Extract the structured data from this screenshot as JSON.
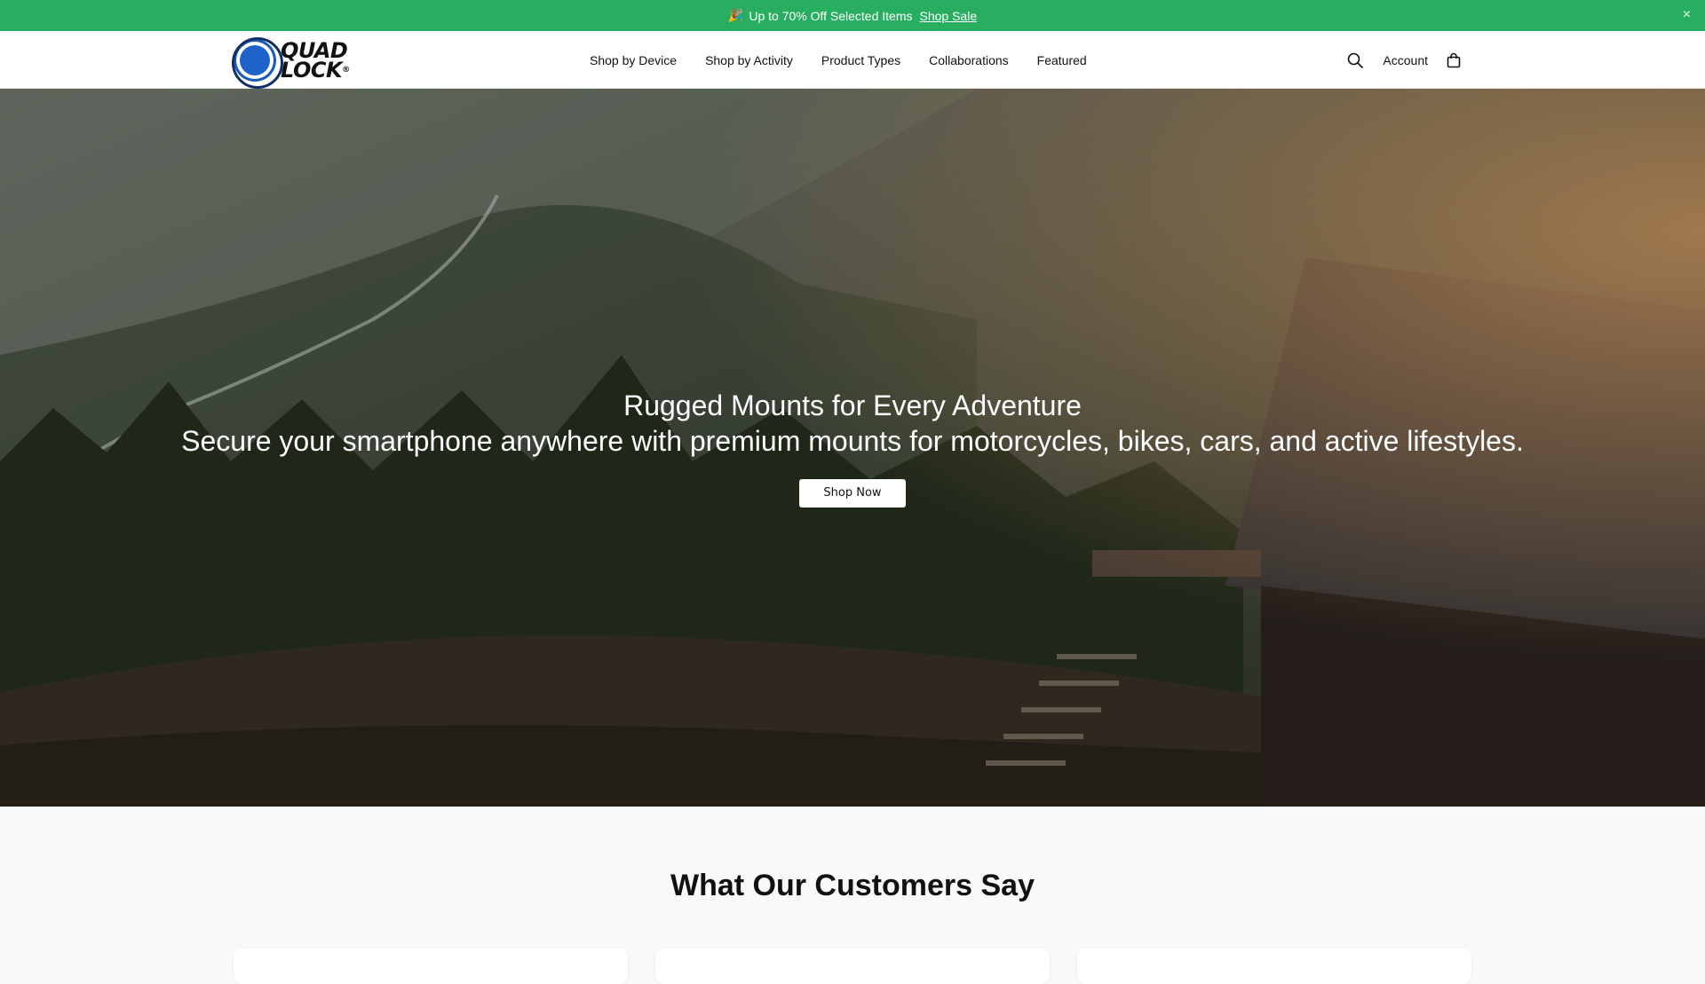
{
  "announcement": {
    "emoji": "🎉",
    "text": "Up to 70% Off Selected Items",
    "link": "Shop Sale",
    "close": "×"
  },
  "header": {
    "logo_line1": "QUAD",
    "logo_line2": "LOCK",
    "logo_reg": "®",
    "nav": [
      "Shop by Device",
      "Shop by Activity",
      "Product Types",
      "Collaborations",
      "Featured"
    ],
    "account_label": "Account"
  },
  "hero": {
    "title": "Rugged Mounts for Every Adventure",
    "subtitle": "Secure your smartphone anywhere with premium mounts for motorcycles, bikes, cars, and active lifestyles.",
    "cta": "Shop Now"
  },
  "testimonials": {
    "heading": "What Our Customers Say"
  },
  "colors": {
    "announcement_bg": "#27ae60",
    "brand_blue": "#1a5ab8"
  },
  "icons": {
    "search": "search-icon",
    "cart": "shopping-bag-icon",
    "close": "close-icon"
  }
}
